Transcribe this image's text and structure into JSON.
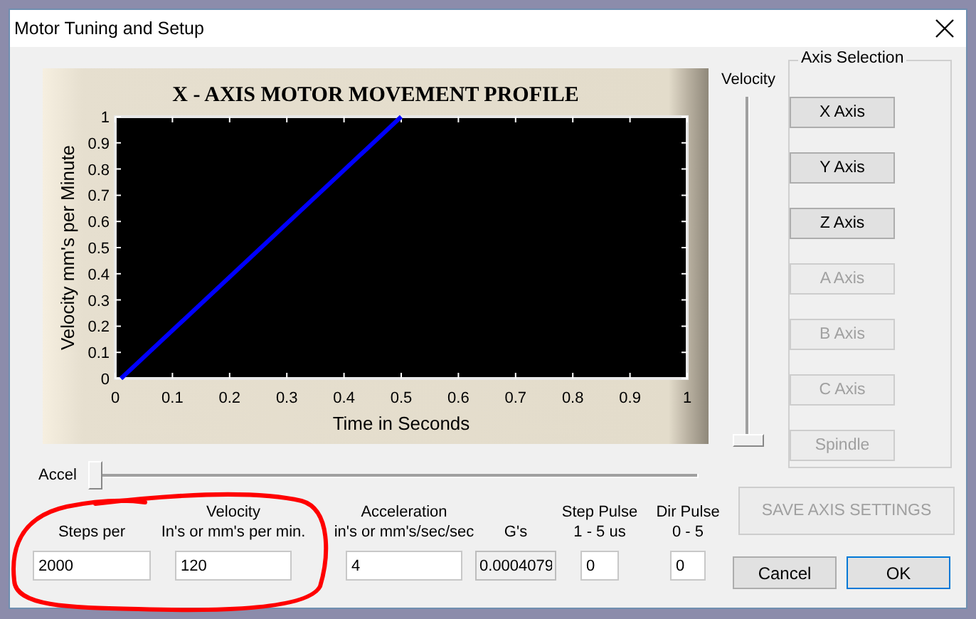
{
  "window": {
    "title": "Motor Tuning and Setup"
  },
  "chart": {
    "chart_data": {
      "type": "line",
      "title": "X - AXIS MOTOR MOVEMENT PROFILE",
      "xlabel": "Time in Seconds",
      "ylabel": "Velocity mm's per Minute",
      "x": [
        0.01,
        0.5
      ],
      "series": [
        {
          "color": "#0000ff",
          "values": [
            0,
            1
          ]
        }
      ],
      "xlim": [
        0,
        1
      ],
      "ylim": [
        0,
        1
      ],
      "xticks": [
        0,
        0.1,
        0.2,
        0.3,
        0.4,
        0.5,
        0.6,
        0.7,
        0.8,
        0.9,
        1
      ],
      "yticks": [
        0,
        0.1,
        0.2,
        0.3,
        0.4,
        0.5,
        0.6,
        0.7,
        0.8,
        0.9,
        1
      ]
    }
  },
  "velocity_slider": {
    "label": "Velocity",
    "level": 0
  },
  "axis_selection": {
    "title": "Axis Selection",
    "buttons": [
      {
        "label": "X Axis",
        "disabled": false
      },
      {
        "label": "Y Axis",
        "disabled": false
      },
      {
        "label": "Z Axis",
        "disabled": false
      },
      {
        "label": "A Axis",
        "disabled": true
      },
      {
        "label": "B Axis",
        "disabled": true
      },
      {
        "label": "C Axis",
        "disabled": true
      },
      {
        "label": "Spindle",
        "disabled": true
      }
    ]
  },
  "accel_slider": {
    "label": "Accel",
    "level": 0
  },
  "fields": [
    {
      "label": [
        "Steps per"
      ],
      "value": "2000",
      "readonly": false
    },
    {
      "label": [
        "Velocity",
        "In's or mm's per min."
      ],
      "value": "120",
      "readonly": false
    },
    {
      "label": [
        "Acceleration",
        "in's or mm's/sec/sec"
      ],
      "value": "4",
      "readonly": false
    },
    {
      "label": [
        "G's"
      ],
      "value": "0.0004079",
      "readonly": true
    },
    {
      "label": [
        "Step Pulse",
        "1 - 5 us"
      ],
      "value": "0",
      "readonly": false
    },
    {
      "label": [
        "Dir Pulse",
        "0 - 5"
      ],
      "value": "0",
      "readonly": false
    }
  ],
  "save_button": {
    "label": "SAVE AXIS SETTINGS",
    "disabled": true
  },
  "buttons": [
    {
      "label": "Cancel",
      "default": false
    },
    {
      "label": "OK",
      "default": true
    }
  ],
  "annotation": {
    "kind": "freehand-circle"
  }
}
